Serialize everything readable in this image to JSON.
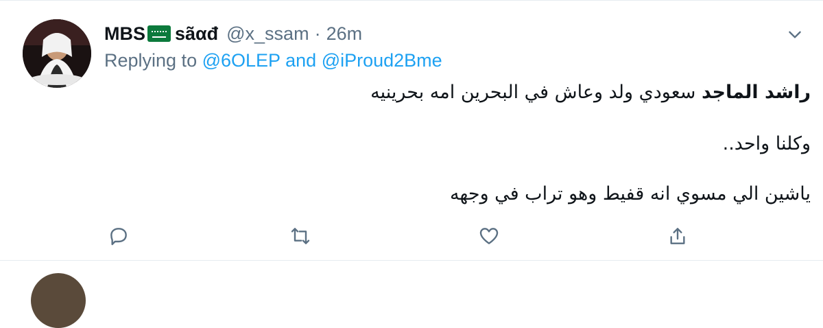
{
  "tweet": {
    "display_name": "MBS",
    "display_suffix": "sãαđ",
    "handle": "@x_ssam",
    "separator": "·",
    "time": "26m",
    "replying_prefix": "Replying to",
    "reply_to_1": "@6OLEP",
    "reply_and": "and",
    "reply_to_2": "@iProud2Bme",
    "body": {
      "line1_bold": "راشد الماجد",
      "line1_rest": " سعودي ولد وعاش في البحرين امه بحرينيه",
      "line2": "وكلنا واحد..",
      "line3": "ياشين الي مسوي انه قفيط وهو تراب في وجهه"
    },
    "icons": {
      "caret": "chevron-down-icon",
      "reply": "reply-icon",
      "retweet": "retweet-icon",
      "like": "heart-icon",
      "share": "share-icon",
      "flag": "saudi-flag-icon"
    },
    "colors": {
      "link": "#1da1f2",
      "muted": "#5b7083",
      "text": "#0f1419",
      "border": "#e6ecf0"
    }
  }
}
